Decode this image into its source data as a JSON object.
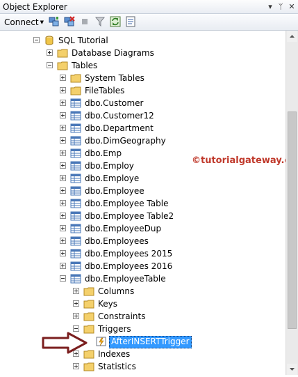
{
  "window": {
    "title": "Object Explorer",
    "pin_icon": "▾",
    "autohide_icon": "ᛘ",
    "close_icon": "✕"
  },
  "toolbar": {
    "connect_label": "Connect",
    "connect_caret": "▼",
    "icons": [
      "connect-object-explorer-icon",
      "disconnect-icon",
      "stop-icon",
      "filter-icon",
      "refresh-icon",
      "summary-icon"
    ]
  },
  "tree": {
    "database": "SQL Tutorial",
    "database_diagrams": "Database Diagrams",
    "tables": "Tables",
    "system_tables": "System Tables",
    "file_tables": "FileTables",
    "table_items": [
      "dbo.Customer",
      "dbo.Customer12",
      "dbo.Department",
      "dbo.DimGeography",
      "dbo.Emp",
      "dbo.Employ",
      "dbo.Employe",
      "dbo.Employee",
      "dbo.Employee Table",
      "dbo.Employee Table2",
      "dbo.EmployeeDup",
      "dbo.Employees",
      "dbo.Employees 2015",
      "dbo.Employees 2016"
    ],
    "employee_table": "dbo.EmployeeTable",
    "columns": "Columns",
    "keys": "Keys",
    "constraints": "Constraints",
    "triggers": "Triggers",
    "trigger_item": "AfterINSERTTrigger",
    "indexes": "Indexes",
    "statistics": "Statistics"
  },
  "watermark": "©tutorialgateway.org",
  "colors": {
    "selection": "#3399ff",
    "folder": "#e8c34f",
    "table_icon": "#4a78b8",
    "arrow": "#7b1f1f",
    "watermark": "#c0392b"
  }
}
